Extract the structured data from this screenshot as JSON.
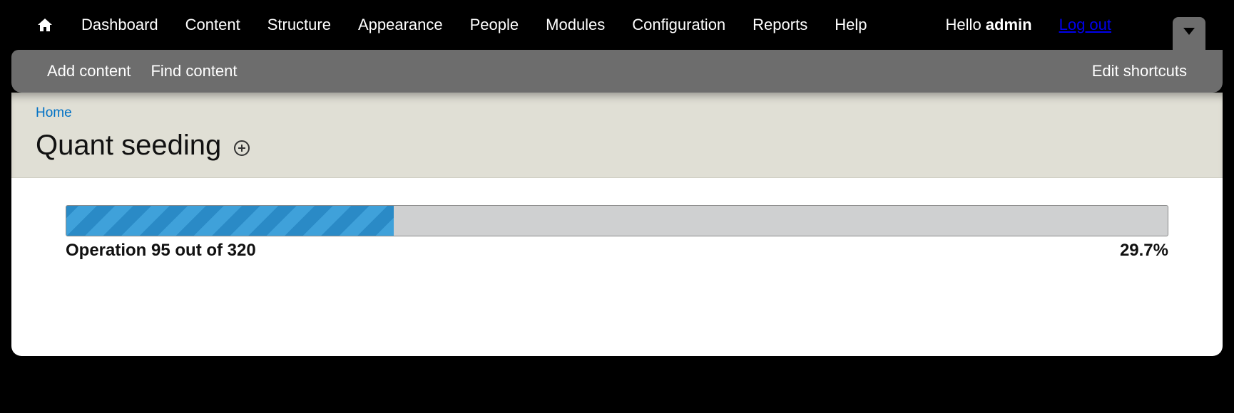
{
  "toolbar": {
    "items": [
      {
        "label": "Dashboard"
      },
      {
        "label": "Content"
      },
      {
        "label": "Structure"
      },
      {
        "label": "Appearance"
      },
      {
        "label": "People"
      },
      {
        "label": "Modules"
      },
      {
        "label": "Configuration"
      },
      {
        "label": "Reports"
      },
      {
        "label": "Help"
      }
    ],
    "greeting_prefix": "Hello ",
    "username": "admin",
    "logout_label": "Log out"
  },
  "shortcut_bar": {
    "add_content_label": "Add content",
    "find_content_label": "Find content",
    "edit_shortcuts_label": "Edit shortcuts"
  },
  "breadcrumb": {
    "home_label": "Home"
  },
  "page": {
    "title": "Quant seeding"
  },
  "progress": {
    "message": "Operation 95 out of 320",
    "current": 95,
    "total": 320,
    "percent_text": "29.7%",
    "percent_value": 29.7
  }
}
